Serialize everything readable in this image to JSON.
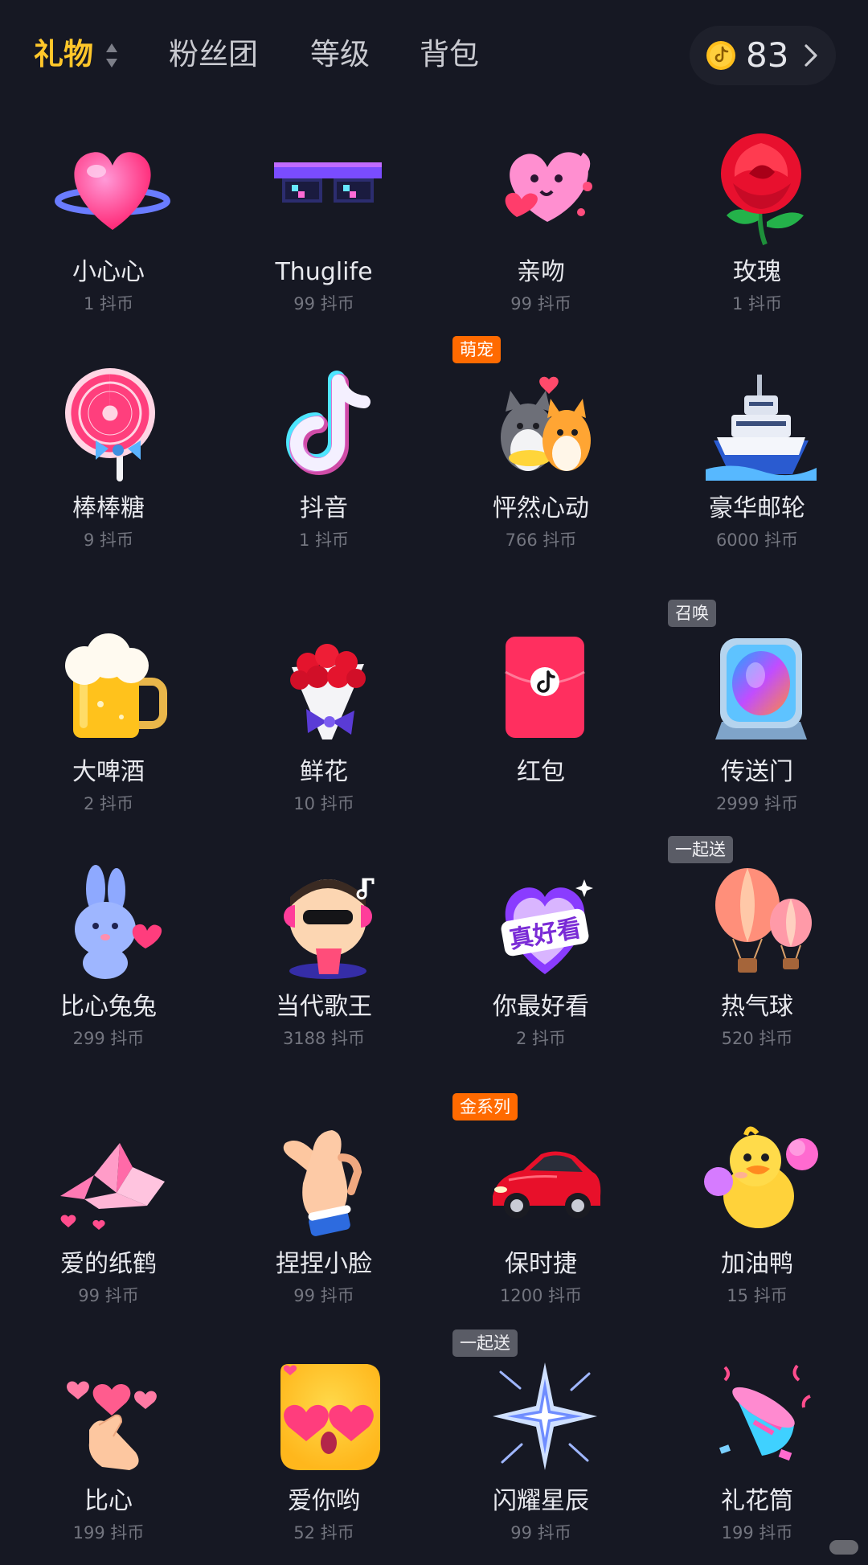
{
  "header": {
    "tabs": [
      {
        "label": "礼物",
        "active": true
      },
      {
        "label": "粉丝团",
        "active": false
      },
      {
        "label": "等级",
        "active": false
      },
      {
        "label": "背包",
        "active": false
      }
    ],
    "sort_icon": "sort-updown-icon",
    "coin_balance": "83",
    "coin_icon": "douyin-coin-icon",
    "chevron_icon": "chevron-right-icon"
  },
  "colors": {
    "background": "#161823",
    "accent": "#ffc72a",
    "tag_orange": "#ff6a00",
    "tag_gray": "#5a5c66",
    "price_text": "#73757f"
  },
  "gifts": [
    {
      "name": "小心心",
      "price": "1 抖币",
      "icon": "heart-icon"
    },
    {
      "name": "Thuglife",
      "price": "99 抖币",
      "icon": "pixel-sunglasses-icon"
    },
    {
      "name": "亲吻",
      "price": "99 抖币",
      "icon": "kissing-heart-icon"
    },
    {
      "name": "玫瑰",
      "price": "1 抖币",
      "icon": "rose-icon"
    },
    {
      "name": "棒棒糖",
      "price": "9 抖币",
      "icon": "lollipop-icon"
    },
    {
      "name": "抖音",
      "price": "1 抖币",
      "icon": "douyin-logo-icon"
    },
    {
      "name": "怦然心动",
      "price": "766 抖币",
      "icon": "cat-and-dog-icon",
      "tag": "萌宠",
      "tag_style": "orange"
    },
    {
      "name": "豪华邮轮",
      "price": "6000 抖币",
      "icon": "cruise-ship-icon"
    },
    {
      "name": "大啤酒",
      "price": "2 抖币",
      "icon": "beer-mug-icon"
    },
    {
      "name": "鲜花",
      "price": "10 抖币",
      "icon": "flower-bouquet-icon"
    },
    {
      "name": "红包",
      "price": "",
      "icon": "red-envelope-icon"
    },
    {
      "name": "传送门",
      "price": "2999 抖币",
      "icon": "portal-icon",
      "tag": "召唤",
      "tag_style": "gray"
    },
    {
      "name": "比心兔兔",
      "price": "299 抖币",
      "icon": "bunny-heart-icon"
    },
    {
      "name": "当代歌王",
      "price": "3188 抖币",
      "icon": "singer-king-icon"
    },
    {
      "name": "你最好看",
      "price": "2 抖币",
      "icon": "heart-badge-icon"
    },
    {
      "name": "热气球",
      "price": "520 抖币",
      "icon": "hot-air-balloon-icon",
      "tag": "一起送",
      "tag_style": "gray"
    },
    {
      "name": "爱的纸鹤",
      "price": "99 抖币",
      "icon": "paper-crane-icon"
    },
    {
      "name": "捏捏小脸",
      "price": "99 抖币",
      "icon": "pinching-hand-icon"
    },
    {
      "name": "保时捷",
      "price": "1200 抖币",
      "icon": "sports-car-icon",
      "tag": "金系列",
      "tag_style": "orange"
    },
    {
      "name": "加油鸭",
      "price": "15 抖币",
      "icon": "cheer-duck-icon"
    },
    {
      "name": "比心",
      "price": "199 抖币",
      "icon": "finger-heart-icon"
    },
    {
      "name": "爱你哟",
      "price": "52 抖币",
      "icon": "love-face-icon"
    },
    {
      "name": "闪耀星辰",
      "price": "99 抖币",
      "icon": "shining-star-icon",
      "tag": "一起送",
      "tag_style": "gray"
    },
    {
      "name": "礼花筒",
      "price": "199 抖币",
      "icon": "party-popper-icon"
    }
  ]
}
